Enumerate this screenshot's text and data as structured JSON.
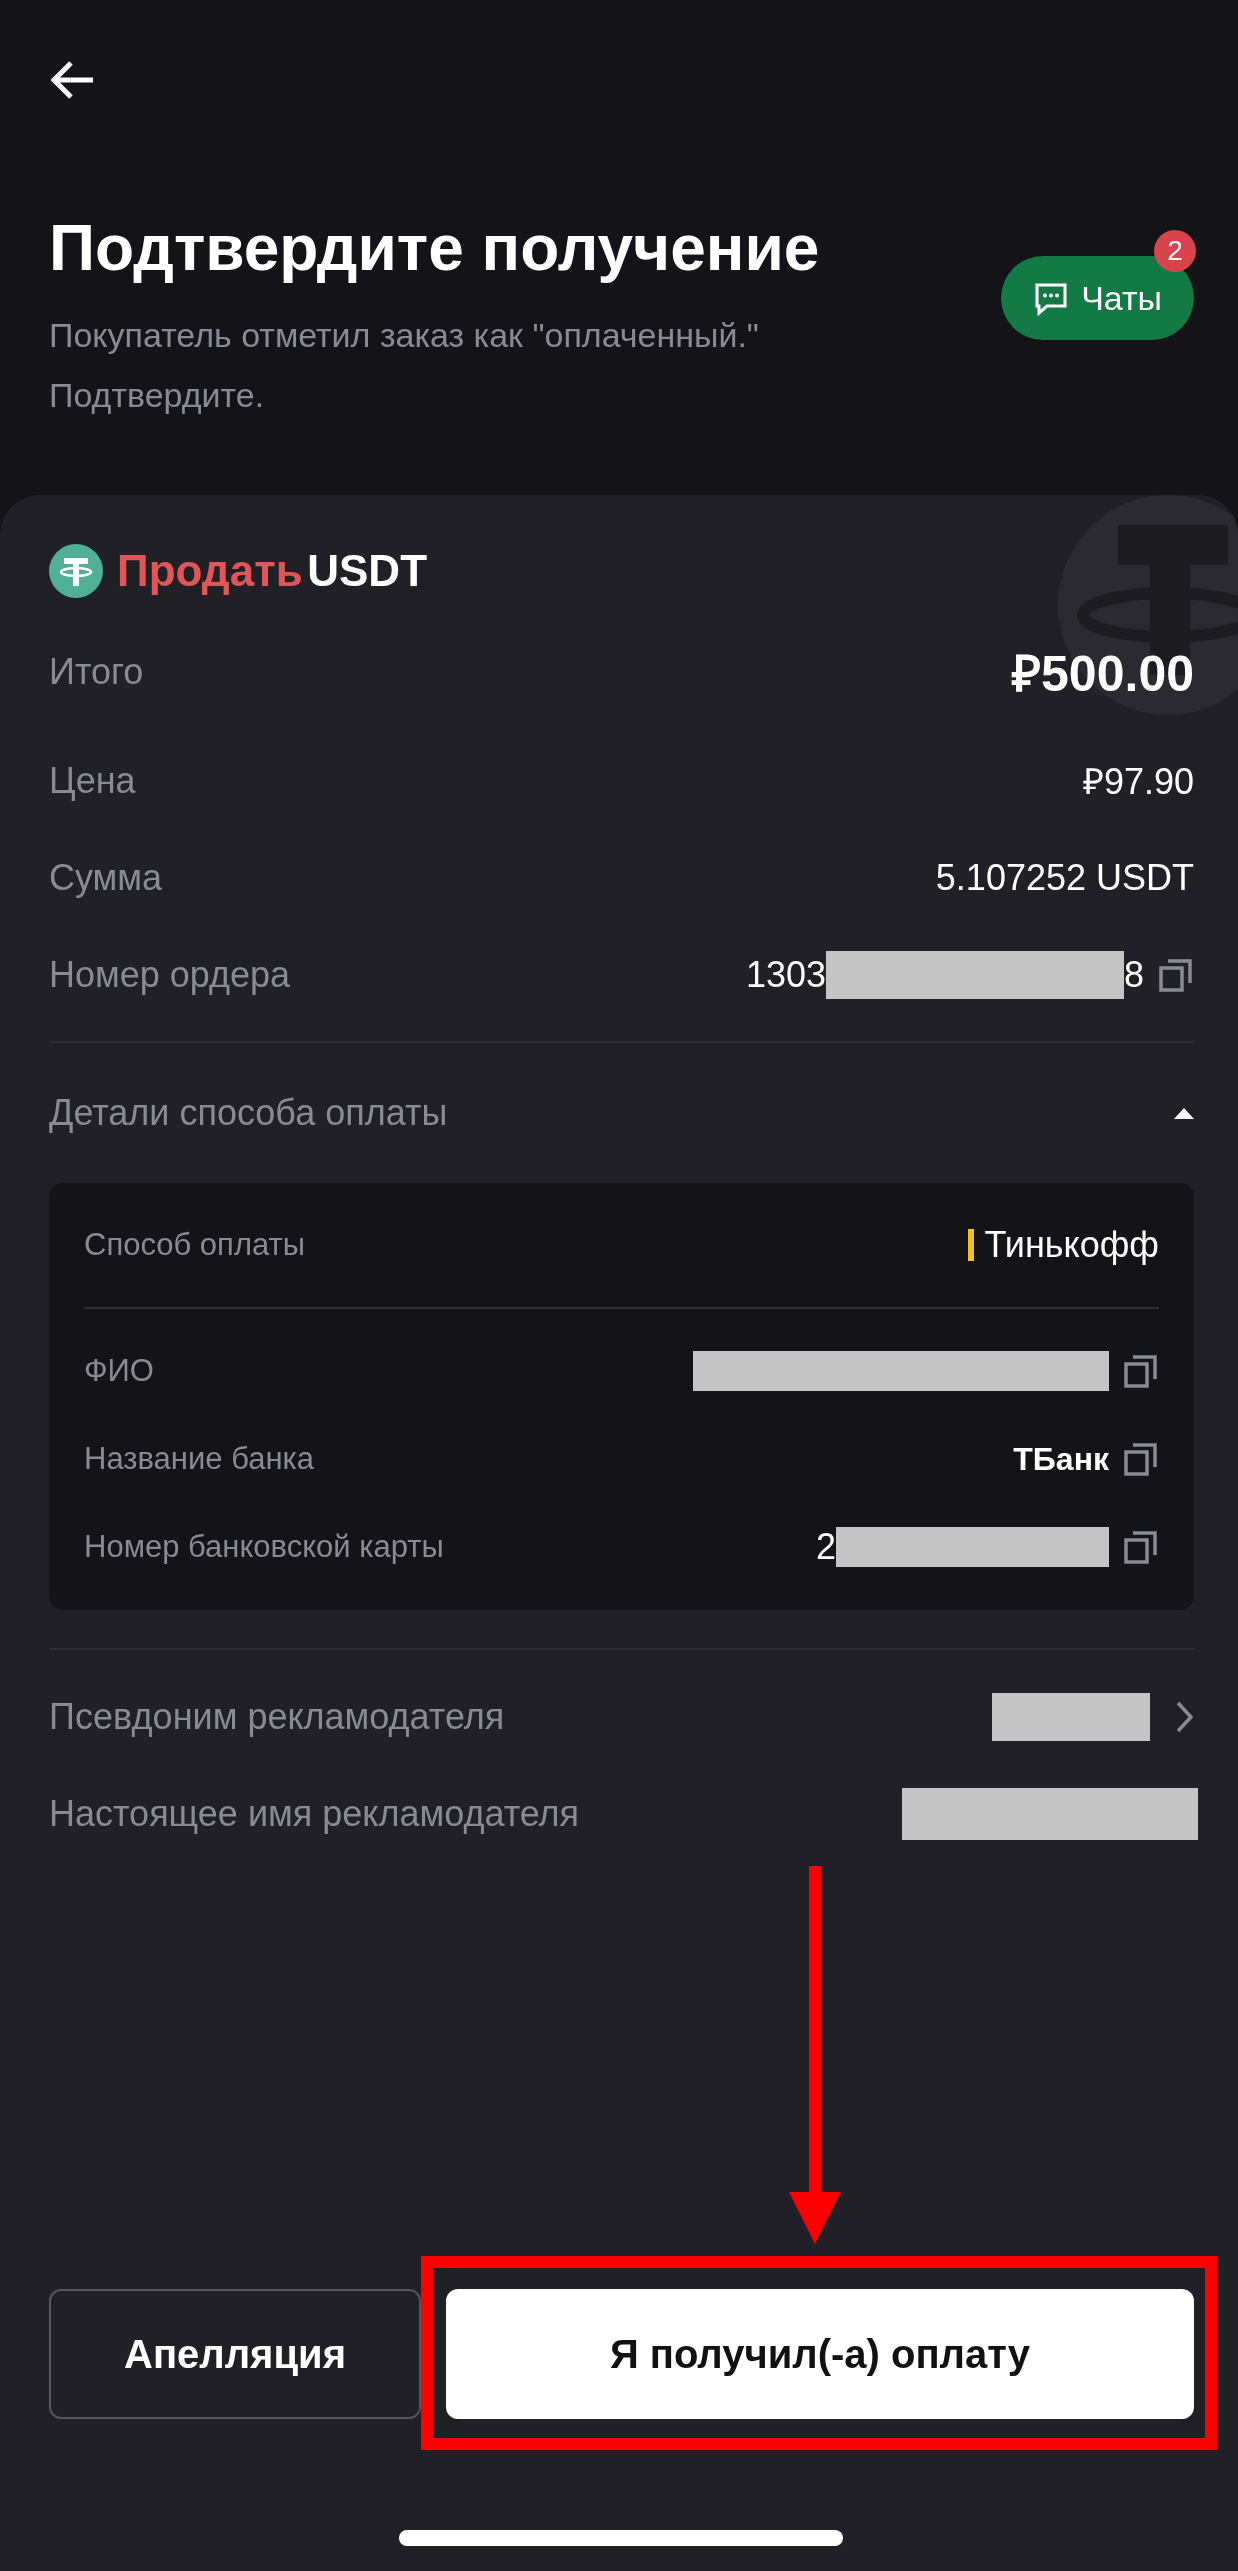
{
  "header": {
    "title": "Подтвердите получение",
    "subtitle": "Покупатель отметил заказ как \"оплаченный.\" Подтвердите.",
    "chat": {
      "label": "Чаты",
      "badge": "2"
    }
  },
  "order": {
    "side": "Продать",
    "asset": "USDT",
    "rows": [
      {
        "kind": "total",
        "label": "Итого",
        "value": "₽500.00"
      },
      {
        "kind": "plain",
        "label": "Цена",
        "value": "₽97.90"
      },
      {
        "kind": "plain",
        "label": "Сумма",
        "value": "5.107252 USDT"
      },
      {
        "kind": "masked",
        "label": "Номер ордера",
        "prefix": "1303",
        "suffix": "8",
        "copy": true
      }
    ]
  },
  "payment": {
    "title": "Детали способа оплаты",
    "expanded": true,
    "method_label": "Способ оплаты",
    "method": "Тинькофф",
    "fields": [
      {
        "kind": "masked",
        "label": "ФИО",
        "copy": true
      },
      {
        "kind": "plain",
        "label": "Название банка",
        "value": "ТБанк",
        "copy": true
      },
      {
        "kind": "masked",
        "label": "Номер банковской карты",
        "prefix": "2",
        "copy": true
      }
    ]
  },
  "advertiser": [
    {
      "kind": "link",
      "label": "Псевдоним рекламодателя"
    },
    {
      "kind": "plain",
      "label": "Настоящее имя рекламодателя"
    }
  ],
  "actions": [
    {
      "kind": "secondary",
      "label": "Апелляция",
      "highlighted": false
    },
    {
      "kind": "primary",
      "label": "Я получил(-а) оплату",
      "highlighted": true
    }
  ]
}
